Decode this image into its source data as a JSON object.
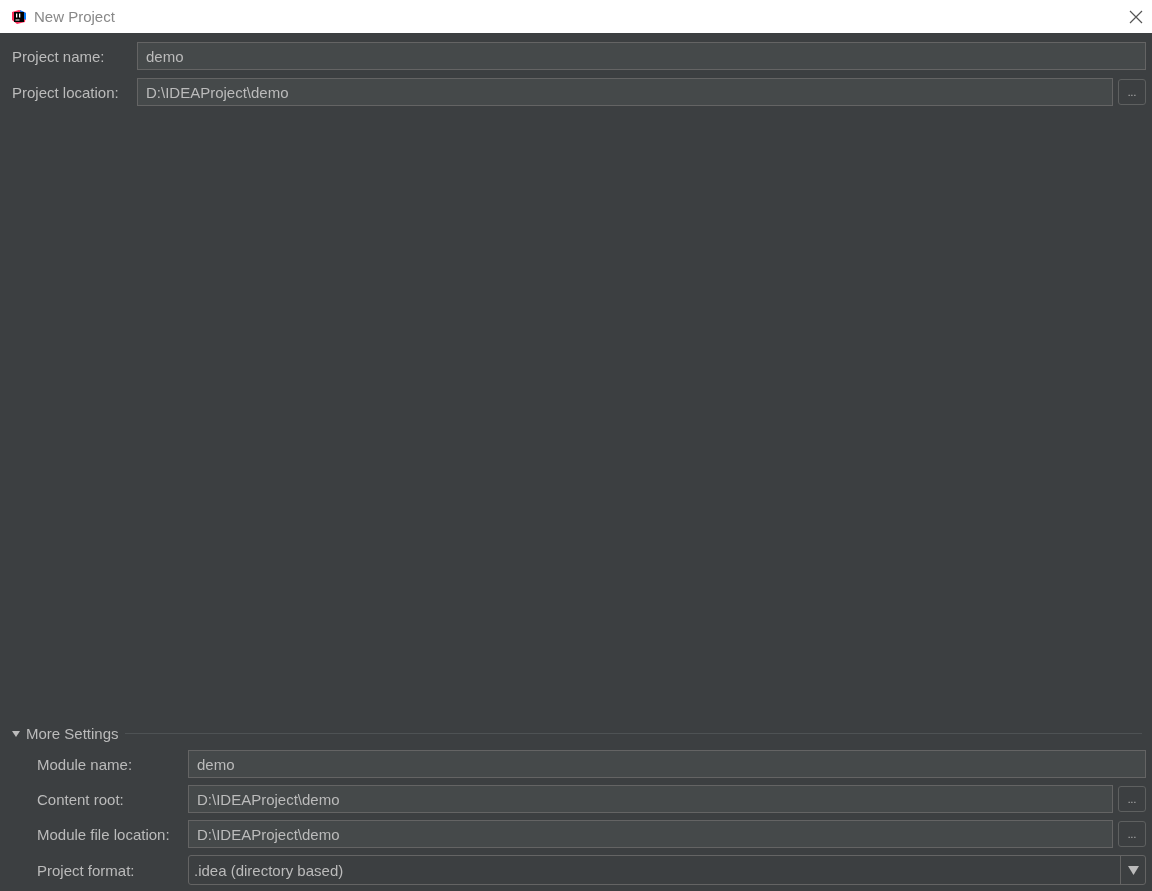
{
  "window": {
    "title": "New Project"
  },
  "fields": [
    {
      "label": "Project name:",
      "value": "demo",
      "kind": "text"
    },
    {
      "label": "Project location:",
      "value": "D:\\IDEAProject\\demo",
      "kind": "path",
      "browse": "..."
    }
  ],
  "more_settings": {
    "label": "More Settings",
    "expanded": true,
    "fields": [
      {
        "label": "Module name:",
        "value": "demo",
        "kind": "text"
      },
      {
        "label": "Content root:",
        "value": "D:\\IDEAProject\\demo",
        "kind": "path",
        "browse": "..."
      },
      {
        "label": "Module file location:",
        "value": "D:\\IDEAProject\\demo",
        "kind": "path",
        "browse": "..."
      },
      {
        "label": "Project format:",
        "value": ".idea (directory based)",
        "kind": "dropdown"
      }
    ]
  }
}
